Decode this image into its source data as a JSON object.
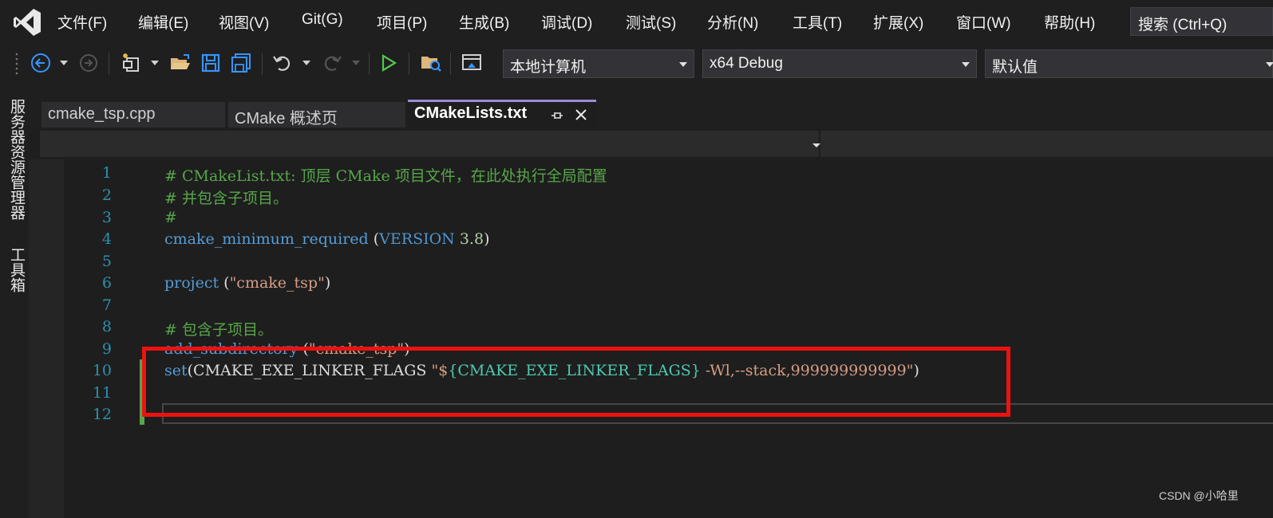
{
  "menubar": {
    "items": [
      "文件(F)",
      "编辑(E)",
      "视图(V)",
      "Git(G)",
      "项目(P)",
      "生成(B)",
      "调试(D)",
      "测试(S)",
      "分析(N)",
      "工具(T)",
      "扩展(X)",
      "窗口(W)",
      "帮助(H)"
    ],
    "search_placeholder": "搜索 (Ctrl+Q)"
  },
  "toolbar": {
    "target_combo": "本地计算机",
    "config_combo": "x64 Debug",
    "default_combo": "默认值"
  },
  "siderail": {
    "server_explorer": "服务器资源管理器",
    "toolbox": "工具箱"
  },
  "tabs": [
    {
      "label": "cmake_tsp.cpp",
      "active": false
    },
    {
      "label": "CMake 概述页",
      "active": false
    },
    {
      "label": "CMakeLists.txt",
      "active": true
    }
  ],
  "editor": {
    "line_numbers": [
      "1",
      "2",
      "3",
      "4",
      "5",
      "6",
      "7",
      "8",
      "9",
      "10",
      "11",
      "12"
    ],
    "line1": "# CMakeList.txt: 顶层 CMake 项目文件，在此处执行全局配置",
    "line2": "# 并包含子项目。",
    "line3": "#",
    "line4": {
      "cmd": "cmake_minimum_required",
      "open": " (",
      "kw": "VERSION",
      "num": " 3.8",
      "close": ")"
    },
    "line6": {
      "cmd": "project",
      "open": " (",
      "str": "\"cmake_tsp\"",
      "close": ")"
    },
    "line8": "# 包含子项目。",
    "line9": {
      "cmd": "add_subdirectory",
      "open": " (",
      "str": "\"cmake_tsp\"",
      "close": ")"
    },
    "line10": {
      "cmd": "set",
      "open": "(CMAKE_EXE_LINKER_FLAGS ",
      "str1": "\"$",
      "var": "{CMAKE_EXE_LINKER_FLAGS}",
      "str2": " -Wl,--stack,999999999999\"",
      "close": ")"
    }
  },
  "watermark": "CSDN @小哈里",
  "colors": {
    "accent_tab": "#9d8bd6",
    "highlight": "#ee1111",
    "change_bar": "#57a64a"
  }
}
